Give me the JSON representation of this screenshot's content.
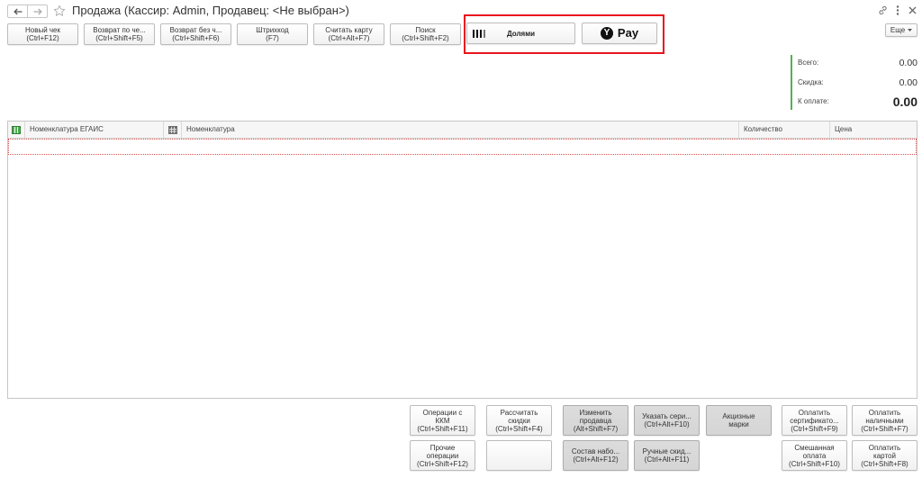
{
  "window": {
    "title": "Продажа (Кассир: Admin, Продавец: <Не выбран>)",
    "icons": {
      "back": "arrow-left-icon",
      "forward": "arrow-right-icon",
      "favorite": "star-icon",
      "link": "link-icon",
      "more": "more-vertical-icon",
      "close": "close-icon"
    }
  },
  "toolbar": {
    "buttons": [
      {
        "label": "Новый чек",
        "shortcut": "(Ctrl+F12)"
      },
      {
        "label": "Возврат по че...",
        "shortcut": "(Ctrl+Shift+F5)"
      },
      {
        "label": "Возврат без ч...",
        "shortcut": "(Ctrl+Shift+F6)"
      },
      {
        "label": "Штрихкод",
        "shortcut": "(F7)"
      },
      {
        "label": "Считать карту",
        "shortcut": "(Ctrl+Alt+F7)"
      },
      {
        "label": "Поиск",
        "shortcut": "(Ctrl+Shift+F2)"
      }
    ],
    "dolyami": {
      "label": "Долями",
      "icon": "dolyami-logo-icon"
    },
    "yandex_pay": {
      "logo_letter": "Y",
      "label": "Pay",
      "icon": "yandex-pay-logo-icon"
    },
    "more": {
      "label": "Еще",
      "icon": "chevron-down-icon"
    }
  },
  "totals": {
    "total": {
      "label": "Всего:",
      "value": "0.00"
    },
    "discount": {
      "label": "Скидка:",
      "value": "0.00"
    },
    "to_pay": {
      "label": "К оплате:",
      "value": "0.00"
    }
  },
  "table": {
    "columns": [
      {
        "icon": "egais-table-icon"
      },
      {
        "label": "Номенклатура ЕГАИС"
      },
      {
        "icon": "hash-icon"
      },
      {
        "label": "Номенклатура"
      },
      {
        "label": "Количество"
      },
      {
        "label": "Цена"
      }
    ],
    "rows": []
  },
  "actions": {
    "row1": [
      {
        "label": "Операции с\nККМ",
        "shortcut": "(Ctrl+Shift+F11)"
      },
      {
        "label": "Рассчитать\nскидки",
        "shortcut": "(Ctrl+Shift+F4)"
      },
      {
        "label": "Изменить\nпродавца",
        "shortcut": "(Alt+Shift+F7)"
      },
      {
        "label": "Указать сери...",
        "shortcut": "(Ctrl+Alt+F10)"
      },
      {
        "label": "Акцизные\nмарки"
      },
      {
        "label": "Оплатить\nсертификато...",
        "shortcut": "(Ctrl+Shift+F9)"
      },
      {
        "label": "Оплатить\nналичными",
        "shortcut": "(Ctrl+Shift+F7)"
      }
    ],
    "row2": [
      {
        "label": "Прочие\nоперации",
        "shortcut": "(Ctrl+Shift+F12)"
      },
      {
        "label": "Состав набо...",
        "shortcut": "(Ctrl+Alt+F12)"
      },
      {
        "label": "Ручные скид...",
        "shortcut": "(Ctrl+Alt+F11)"
      },
      {
        "label": "Смешанная\nоплата",
        "shortcut": "(Ctrl+Shift+F10)"
      },
      {
        "label": "Оплатить\nкартой",
        "shortcut": "(Ctrl+Shift+F8)"
      }
    ]
  },
  "colors": {
    "highlight_border": "#e8141d",
    "totals_accent": "#55b055",
    "inactive_button": "#d5d5d5"
  }
}
